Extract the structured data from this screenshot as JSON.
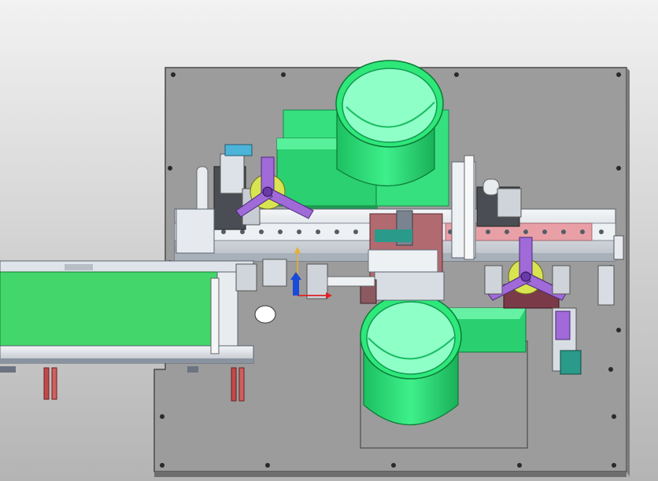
{
  "scene": {
    "description_visible_text": "",
    "colors": {
      "background_top": "#f2f2f2",
      "background_bottom": "#b4b4b4",
      "base_plate": "#9c9c9c",
      "base_plate_edge": "#5a5a5a",
      "bowl_green": "#2ee87a",
      "bowl_rim": "#8fffc8",
      "hopper_green": "#3be884",
      "rail_silver": "#d8dde3",
      "rail_dark": "#6b7480",
      "purple_arm": "#a06ad8",
      "pink_plate": "#e8a0a6",
      "maroon_block": "#7a3a48",
      "conveyor_belt": "#43d66a",
      "leg_red": "#c04a4a",
      "teal_block": "#2a9a8a",
      "axis_red": "#e02020",
      "axis_blue": "#1a4ad8",
      "axis_orange": "#e8b030"
    },
    "icons": [
      "vibratory-bowl-feeder",
      "rotary-gripper-arm",
      "conveyor-belt",
      "linear-rail",
      "coordinate-axis-triad"
    ]
  }
}
